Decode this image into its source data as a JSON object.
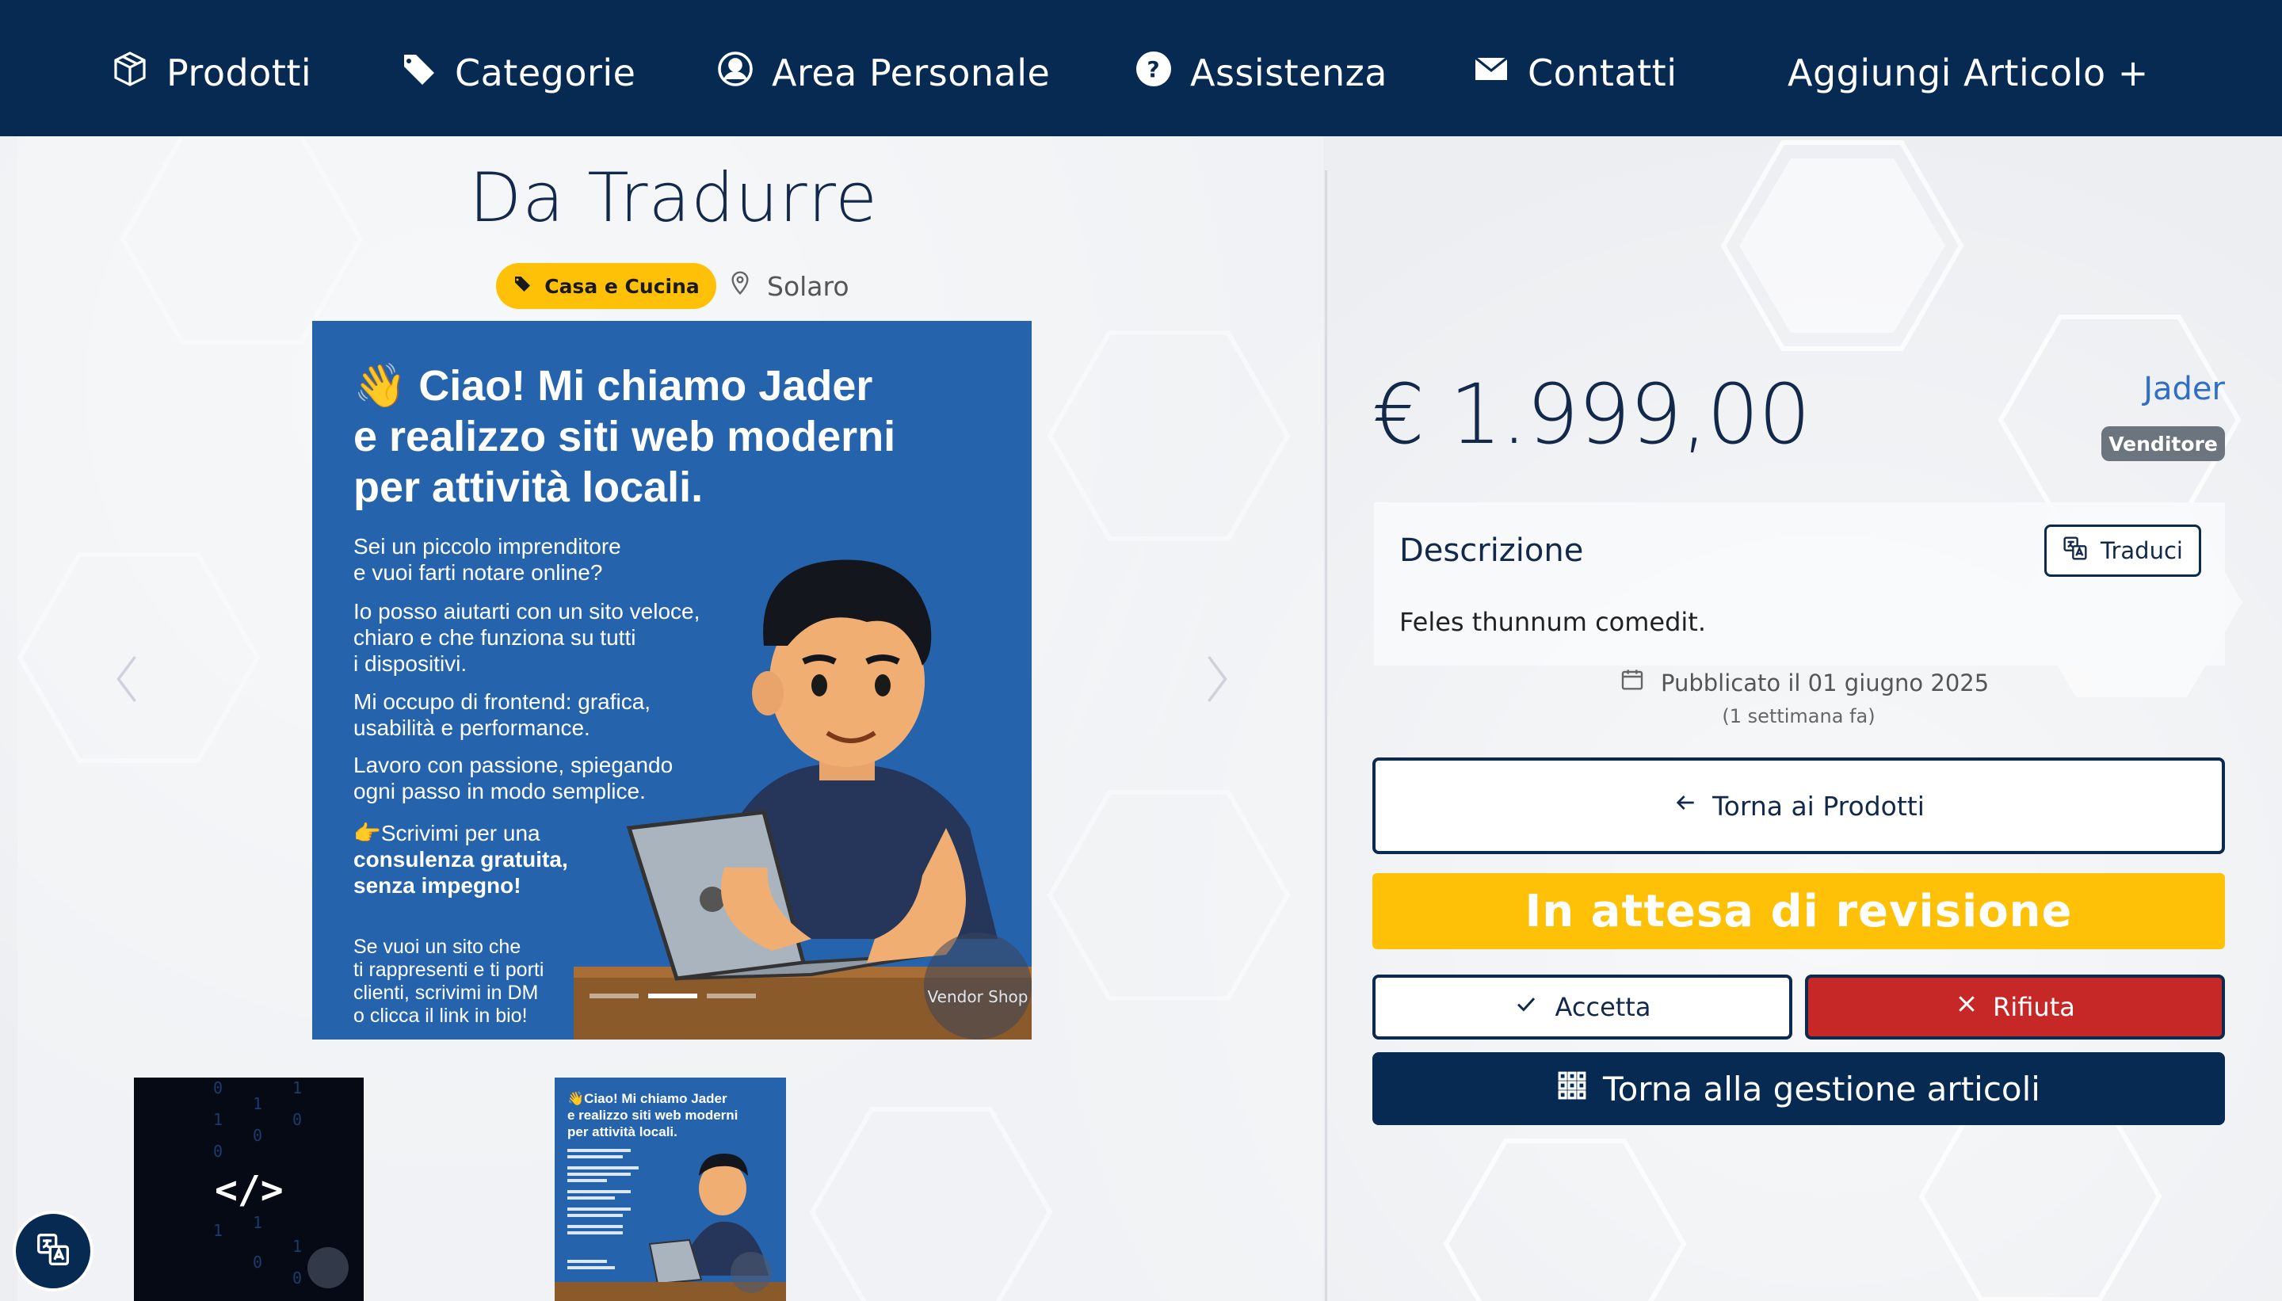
{
  "nav": {
    "items": [
      {
        "label": "Prodotti",
        "icon": "box-icon"
      },
      {
        "label": "Categorie",
        "icon": "tag-icon"
      },
      {
        "label": "Area Personale",
        "icon": "user-circle-icon"
      },
      {
        "label": "Assistenza",
        "icon": "question-circle-icon"
      },
      {
        "label": "Contatti",
        "icon": "envelope-icon"
      }
    ],
    "add_article": "Aggiungi Articolo +"
  },
  "product": {
    "title": "Da Tradurre",
    "category": "Casa e Cucina",
    "location": "Solaro",
    "price": "€ 1.999,00",
    "seller": "Jader",
    "seller_badge": "Venditore",
    "description_title": "Descrizione",
    "translate_label": "Traduci",
    "description": "Feles thunnum comedit.",
    "published": "Pubblicato il 01 giugno 2025",
    "published_relative": "(1 settimana fa)"
  },
  "image": {
    "headline_1": "👋 Ciao! Mi chiamo Jader",
    "headline_2": "e realizzo siti web moderni",
    "headline_3": "per attività locali.",
    "p1": "Sei un piccolo imprenditore\ne vuoi farti notare online?",
    "p2": "Io posso aiutarti con un sito veloce,\nchiaro e che funziona su tutti\ni dispositivi.",
    "p3": "Mi occupo di frontend: grafica,\nusabilità e performance.",
    "p4": "Lavoro con passione, spiegando\nogni passo in modo semplice.",
    "p5_a": "👉Scrivimi per una",
    "p5_b": "consulenza gratuita,\nsenza impegno!",
    "p6": "Se vuoi un sito che\nti rappresenti e ti porti\nclienti, scrivimi in DM\no clicca il link in bio!",
    "watermark": "Vendor Shop",
    "thumb1_code": "</>",
    "slides_total": 3,
    "slide_active": 2
  },
  "actions": {
    "back": "Torna ai Prodotti",
    "status": "In attesa di revisione",
    "accept": "Accetta",
    "reject": "Rifiuta",
    "manage": "Torna alla gestione articoli"
  },
  "colors": {
    "nav_bg": "#062a52",
    "accent_yellow": "#ffc107",
    "reject_red": "#c62828",
    "link_blue": "#2f6fc4"
  }
}
